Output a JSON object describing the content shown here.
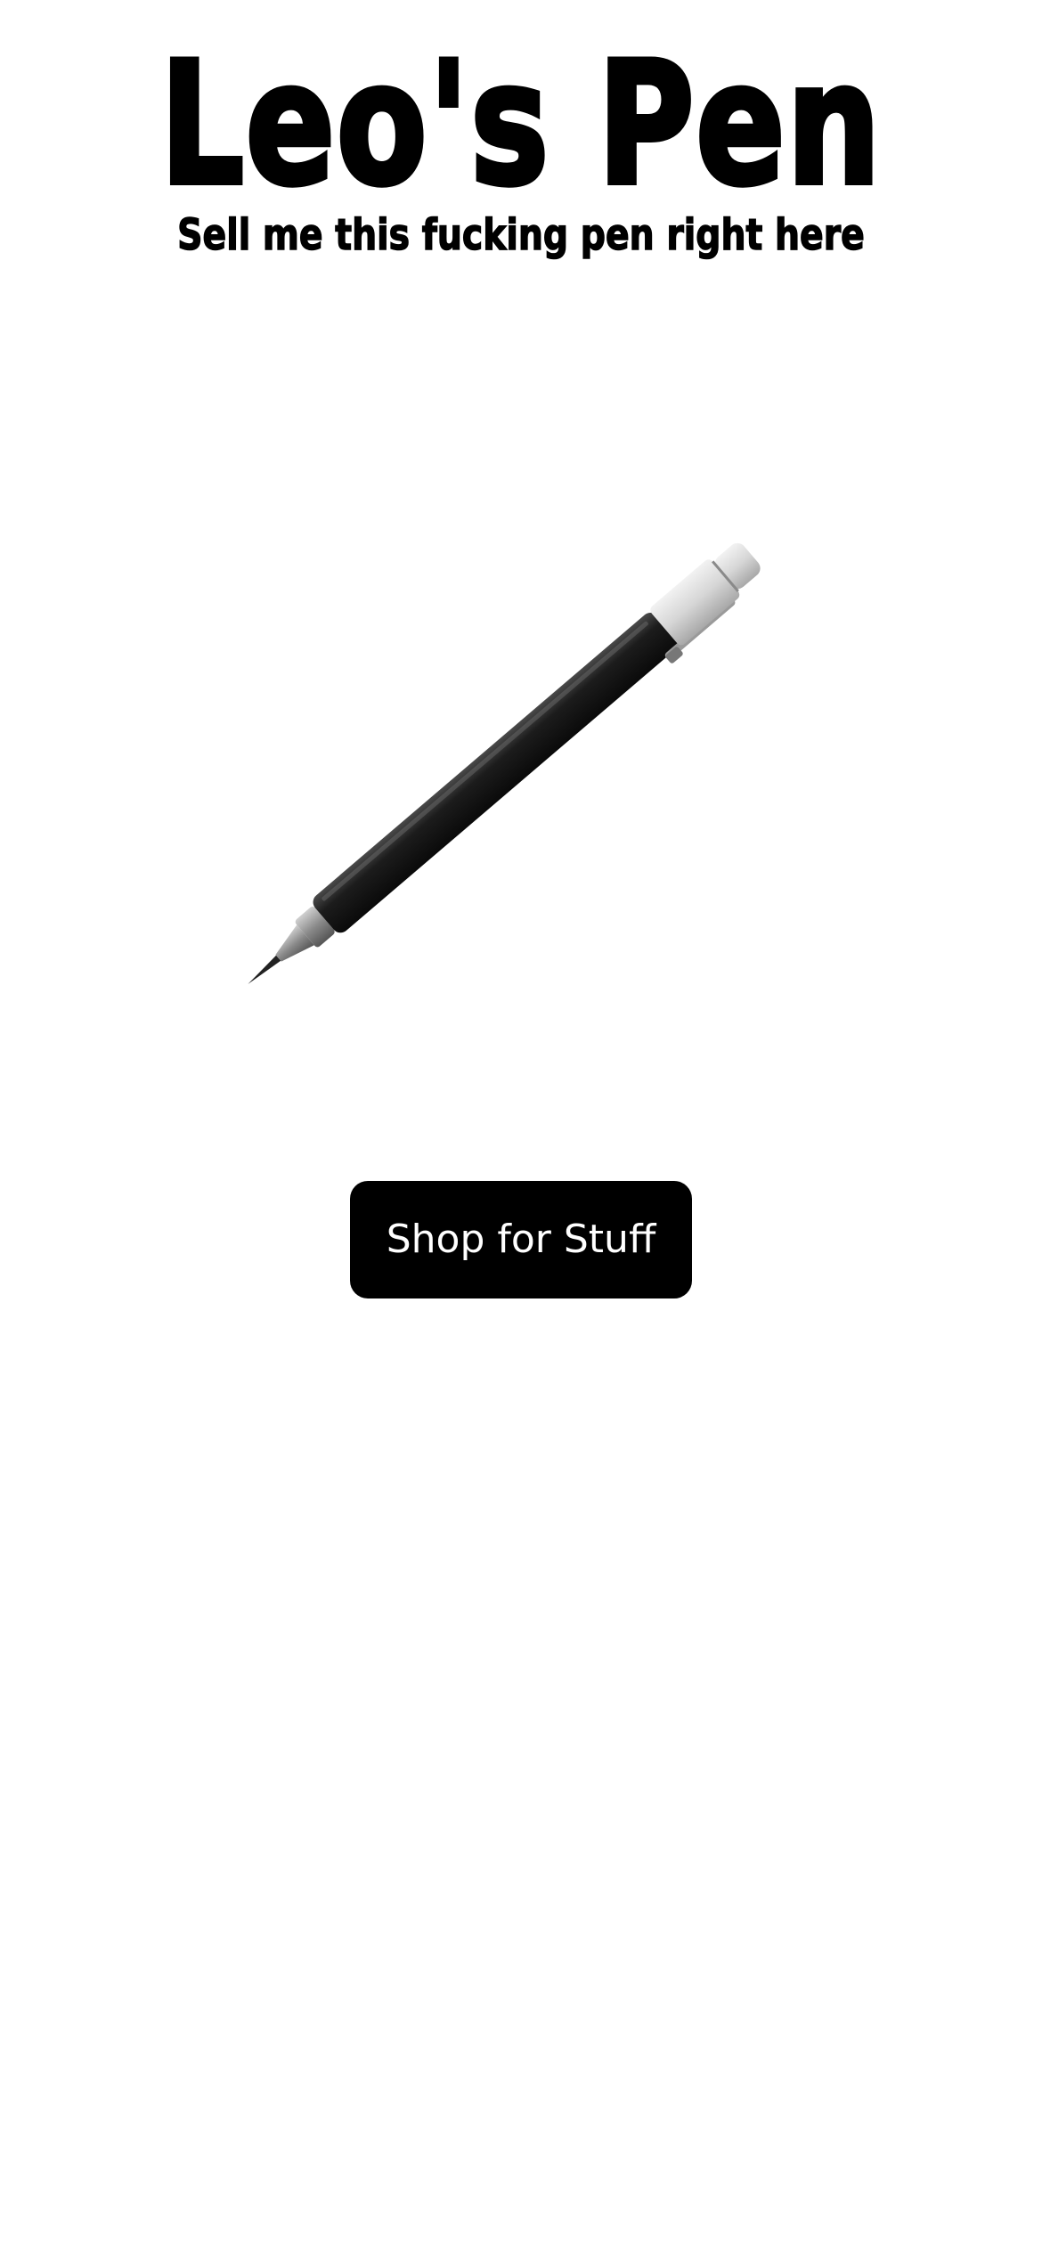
{
  "header": {
    "title": "Leo's Pen",
    "subtitle": "Sell me this fucking pen right here"
  },
  "hero": {
    "image_icon": "pen-icon"
  },
  "cta": {
    "label": "Shop for Stuff"
  },
  "colors": {
    "background": "#ffffff",
    "text": "#000000",
    "button_bg": "#000000",
    "button_text": "#ffffff"
  }
}
